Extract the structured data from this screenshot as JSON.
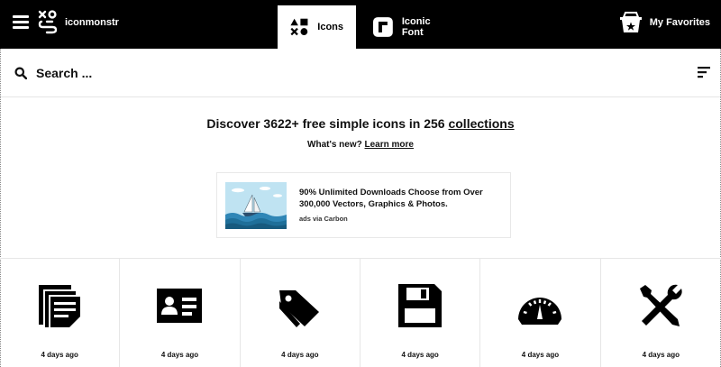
{
  "header": {
    "logo_text": "iconmonstr",
    "tabs": [
      {
        "label": "Icons",
        "active": true
      },
      {
        "label": "Iconic Font",
        "active": false
      }
    ],
    "favorites_label": "My Favorites"
  },
  "search": {
    "placeholder": "Search ..."
  },
  "intro": {
    "headline_prefix": "Discover 3622+ free simple icons in 256 ",
    "headline_link": "collections",
    "whats_new": "What's new?",
    "learn_more": "Learn more"
  },
  "ad": {
    "text": "90% Unlimited Downloads Choose from Over 300,000 Vectors, Graphics & Photos.",
    "via": "ads via Carbon"
  },
  "icons": [
    {
      "icon": "document-stack-icon",
      "updated": "4 days ago"
    },
    {
      "icon": "id-card-icon",
      "updated": "4 days ago"
    },
    {
      "icon": "tags-icon",
      "updated": "4 days ago"
    },
    {
      "icon": "floppy-disk-icon",
      "updated": "4 days ago"
    },
    {
      "icon": "speedometer-icon",
      "updated": "4 days ago"
    },
    {
      "icon": "tools-icon",
      "updated": "4 days ago"
    }
  ],
  "colors": {
    "bar": "#000000",
    "background": "#ffffff",
    "divider": "#e6e6e6"
  }
}
